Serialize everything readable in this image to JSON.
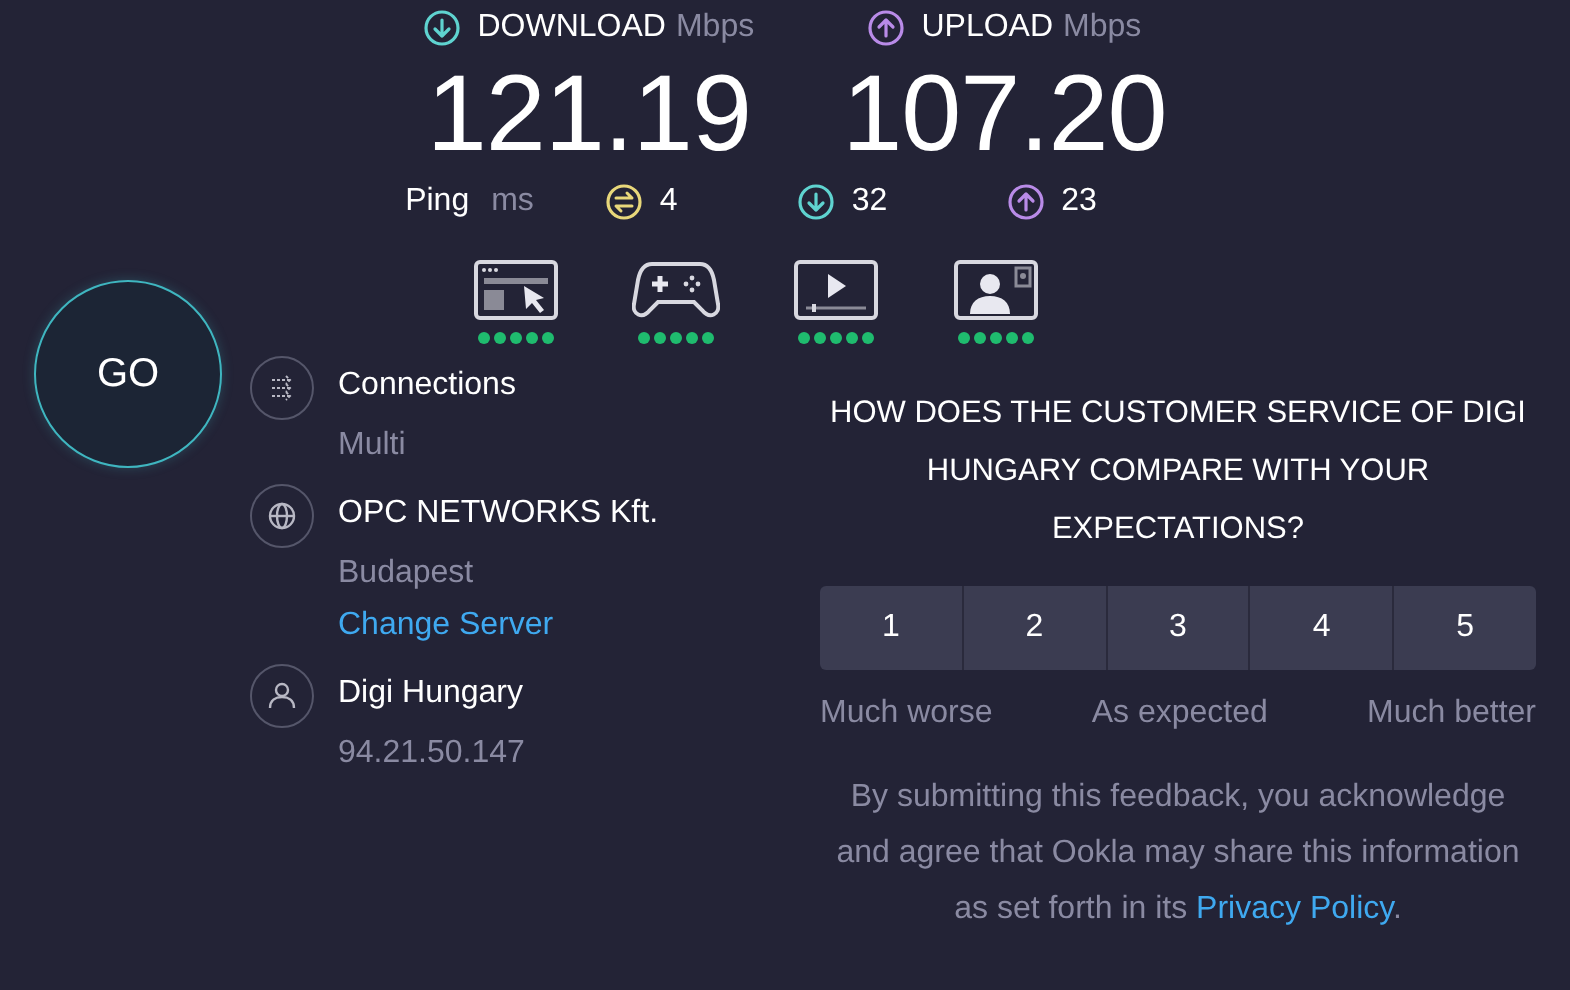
{
  "download": {
    "label": "DOWNLOAD",
    "unit": "Mbps",
    "value": "121.19"
  },
  "upload": {
    "label": "UPLOAD",
    "unit": "Mbps",
    "value": "107.20"
  },
  "ping": {
    "label": "Ping",
    "unit": "ms",
    "readings": [
      {
        "kind": "idle",
        "value": "4",
        "color": "#e8d77a"
      },
      {
        "kind": "download",
        "value": "32",
        "color": "#5fd3d0"
      },
      {
        "kind": "upload",
        "value": "23",
        "color": "#b98be8"
      }
    ]
  },
  "ratings": [
    {
      "kind": "browsing",
      "stars": 5
    },
    {
      "kind": "gaming",
      "stars": 5
    },
    {
      "kind": "video",
      "stars": 5
    },
    {
      "kind": "video_call",
      "stars": 5
    }
  ],
  "go_button": "GO",
  "info": [
    {
      "kind": "connections",
      "title": "Connections",
      "subtitle": "Multi"
    },
    {
      "kind": "server",
      "title": "OPC NETWORKS Kft.",
      "subtitle": "Budapest",
      "link": "Change Server"
    },
    {
      "kind": "provider",
      "title": "Digi Hungary",
      "subtitle": "94.21.50.147"
    }
  ],
  "survey": {
    "question": "HOW DOES THE CUSTOMER SERVICE OF DIGI HUNGARY COMPARE WITH YOUR EXPECTATIONS?",
    "options": [
      {
        "label": "1",
        "selected": false
      },
      {
        "label": "2",
        "selected": false
      },
      {
        "label": "3",
        "selected": false
      },
      {
        "label": "4",
        "selected": false
      },
      {
        "label": "5",
        "selected": false
      }
    ],
    "scale_labels": [
      "Much worse",
      "As expected",
      "Much better"
    ],
    "disclaimer": "By submitting this feedback, you acknowledge and agree that Ookla may share this information as set forth in its",
    "link": "Privacy Policy",
    "end": "."
  }
}
